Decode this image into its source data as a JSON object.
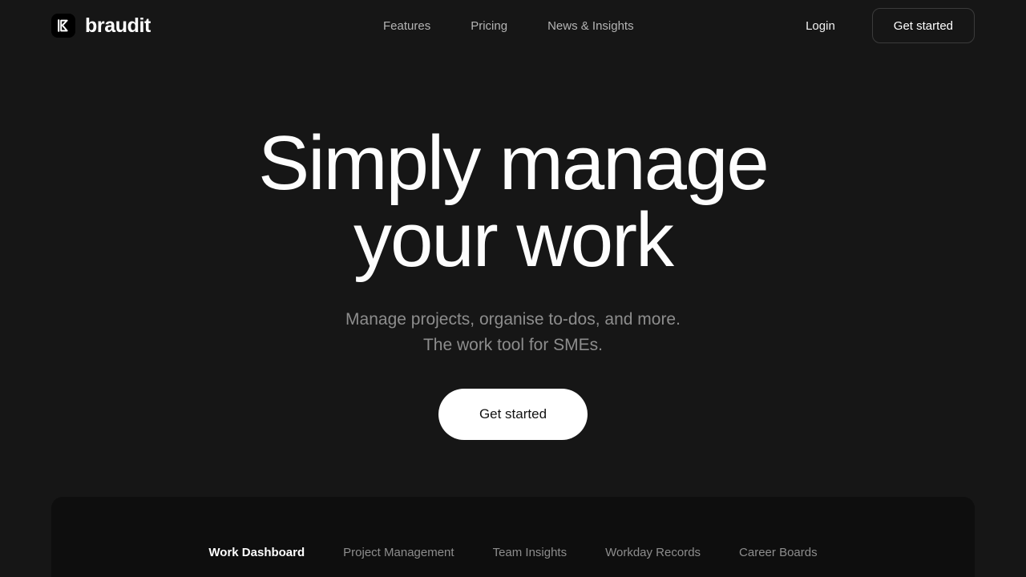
{
  "brand": {
    "name": "braudit",
    "mark_icon": "braudit-bracket-logo-icon"
  },
  "header": {
    "nav_links": [
      {
        "label": "Features"
      },
      {
        "label": "Pricing"
      },
      {
        "label": "News & Insights"
      }
    ],
    "login_label": "Login",
    "cta_label": "Get started"
  },
  "hero": {
    "title_line1": "Simply manage",
    "title_line2": "your work",
    "subtitle_line1": "Manage projects, organise to-dos, and more.",
    "subtitle_line2": "The work tool for SMEs.",
    "cta_label": "Get started"
  },
  "showcase": {
    "tabs": [
      {
        "label": "Work Dashboard",
        "active": true
      },
      {
        "label": "Project Management",
        "active": false
      },
      {
        "label": "Team Insights",
        "active": false
      },
      {
        "label": "Workday Records",
        "active": false
      },
      {
        "label": "Career Boards",
        "active": false
      }
    ]
  },
  "colors": {
    "page_background": "#161616",
    "panel_background": "#0e0e0e",
    "text_primary": "#fdfdfd",
    "text_muted": "#8d8d8d",
    "nav_text": "#b4b4b4",
    "border": "#3b3b3b",
    "cta_background": "#ffffff",
    "cta_text": "#121212"
  }
}
